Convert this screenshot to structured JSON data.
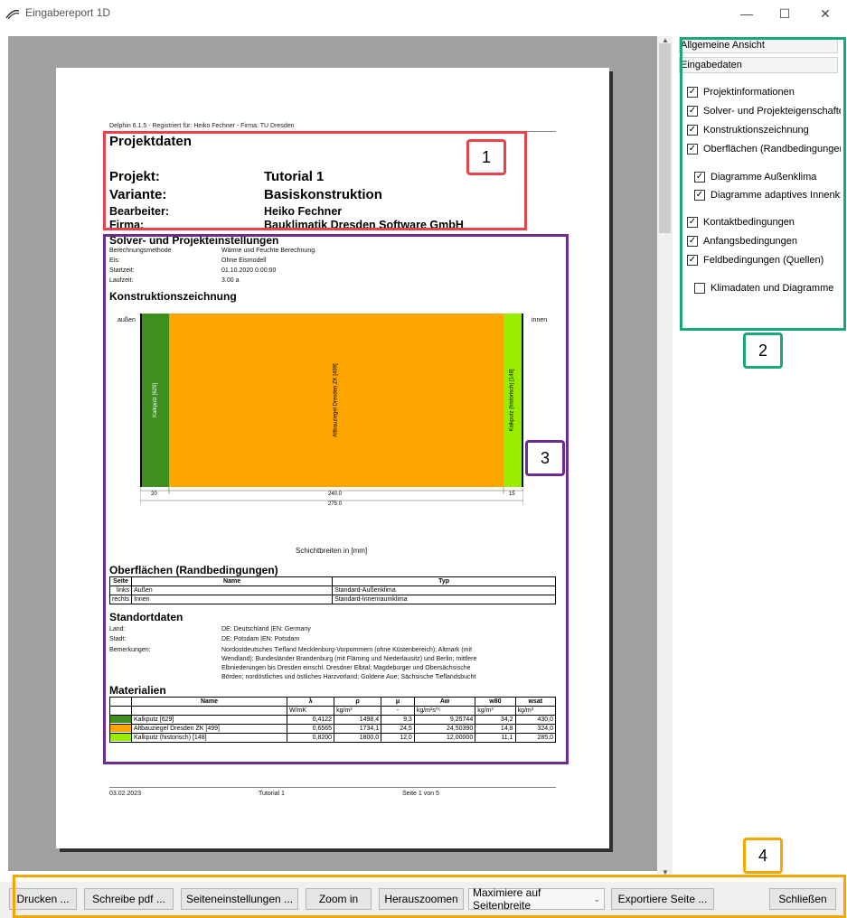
{
  "window": {
    "title": "Eingabereport 1D",
    "minimize_glyph": "—",
    "maximize_glyph": "☐",
    "close_glyph": "✕"
  },
  "report": {
    "header_text": "Delphin 6.1.5 - Registriert für: Heiko Fechner - Firma: TU Dresden",
    "projektdaten": {
      "heading": "Projektdaten",
      "projekt_label": "Projekt:",
      "projekt_value": "Tutorial 1",
      "variante_label": "Variante:",
      "variante_value": "Basiskonstruktion",
      "bearbeiter_label": "Bearbeiter:",
      "bearbeiter_value": "Heiko Fechner",
      "firma_label": "Firma:",
      "firma_value": "Bauklimatik Dresden Software GmbH"
    },
    "solver": {
      "heading": "Solver- und Projekteinstellungen",
      "rows": [
        {
          "label": "Berechnungsmethode",
          "value": "Wärme und Feuchte Berechnung."
        },
        {
          "label": "Eis:",
          "value": "Ohne Eismodell"
        },
        {
          "label": "Startzeit:",
          "value": "01.10.2020 0:00:00"
        },
        {
          "label": "Laufzeit:",
          "value": "3.00 a"
        }
      ]
    },
    "konstruktion": {
      "heading": "Konstruktionszeichnung",
      "left_label": "außen",
      "right_label": "innen",
      "layers": [
        {
          "name": "Kalkputz [629]",
          "thickness": "20",
          "color": "#3f8f1f"
        },
        {
          "name": "Altbauziegel Dresden ZK [499]",
          "thickness": "240.0",
          "color": "#ffa500"
        },
        {
          "name": "Kalkputz (historisch) [148]",
          "thickness": "15",
          "color": "#99ee00"
        }
      ],
      "total": "275.0",
      "caption": "Schichtbreiten in [mm]"
    },
    "oberflaechen": {
      "heading": "Oberflächen (Randbedingungen)",
      "columns": [
        "Seite",
        "Name",
        "Typ"
      ],
      "rows": [
        [
          "links",
          "Außen",
          "Standard-Außenklima"
        ],
        [
          "rechts",
          "Innen",
          "Standard-Innenraumklima"
        ]
      ]
    },
    "standort": {
      "heading": "Standortdaten",
      "land_label": "Land:",
      "land_value": "DE: Deutschland |EN: Germany",
      "stadt_label": "Stadt:",
      "stadt_value": "DE: Potsdam |EN: Potsdam",
      "bemerkungen_label": "Bemerkungen:",
      "bemerkungen_lines": [
        "Nordostdeutsches Tiefland Mecklenburg-Vorpommern (ohne Küstenbereich); Altmark (mit",
        "Wendland); Bundesländer Brandenburg (mit Fläming und Niederlausitz) und Berlin; mittlere",
        "Elbniederungen bis Dresden einschl. Dresdner Elbtal; Magdeburger und Obersächsische",
        "Börden; nordöstliches und östliches Harzvorland; Goldene Aue; Sächsische Tieflandsbucht"
      ]
    },
    "materialien": {
      "heading": "Materialien",
      "columns": [
        "",
        "Name",
        "λ",
        "ρ",
        "μ",
        "Aw",
        "w80",
        "wsat"
      ],
      "units": [
        "",
        "",
        "W/mK",
        "kg/m³",
        "-",
        "kg/m²s⁰⁵",
        "kg/m³",
        "kg/m³"
      ],
      "rows": [
        {
          "color": "#3f8f1f",
          "name": "Kalkputz [629]",
          "lambda": "0,4122",
          "rho": "1498,4",
          "mu": "9,3",
          "aw": "9,25744",
          "w80": "34,2",
          "wsat": "430,0"
        },
        {
          "color": "#ffa500",
          "name": "Altbauziegel Dresden ZK [499]",
          "lambda": "0,6565",
          "rho": "1734,1",
          "mu": "24,5",
          "aw": "24,50390",
          "w80": "14,8",
          "wsat": "324,0"
        },
        {
          "color": "#99ee00",
          "name": "Kalkputz (historisch) [148]",
          "lambda": "0,8200",
          "rho": "1800,0",
          "mu": "12,0",
          "aw": "12,00000",
          "w80": "11,1",
          "wsat": "285,0"
        }
      ]
    },
    "footer": {
      "date": "03.02.2023",
      "project": "Tutorial 1",
      "page": "Seite 1 von 5"
    }
  },
  "sidepanel": {
    "btn_general": "Allgemeine Ansicht",
    "btn_input": "Eingabedaten",
    "options": [
      {
        "label": "Projektinformationen",
        "checked": true
      },
      {
        "label": "Solver- und Projekteigenschaften",
        "checked": true
      },
      {
        "label": "Konstruktionszeichnung",
        "checked": true
      },
      {
        "label": "Oberflächen (Randbedingungen)",
        "checked": true
      },
      {
        "label": "Diagramme Außenklima",
        "checked": true
      },
      {
        "label": "Diagramme adaptives Innenklima",
        "checked": true
      },
      {
        "label": "Kontaktbedingungen",
        "checked": true
      },
      {
        "label": "Anfangsbedingungen",
        "checked": true
      },
      {
        "label": "Feldbedingungen (Quellen)",
        "checked": true
      },
      {
        "label": "Klimadaten und Diagramme",
        "checked": false
      }
    ]
  },
  "toolbar": {
    "print": "Drucken ...",
    "write_pdf": "Schreibe pdf ...",
    "page_settings": "Seiteneinstellungen ...",
    "zoom_in": "Zoom in",
    "zoom_out": "Herauszoomen",
    "zoom_mode": "Maximiere auf Seitenbreite",
    "export_page": "Exportiere Seite ...",
    "close": "Schließen"
  },
  "annotations": [
    {
      "number": "1",
      "color": "#e8434a"
    },
    {
      "number": "2",
      "color": "#1aa878"
    },
    {
      "number": "3",
      "color": "#6b2d8f"
    },
    {
      "number": "4",
      "color": "#f5a700"
    }
  ]
}
